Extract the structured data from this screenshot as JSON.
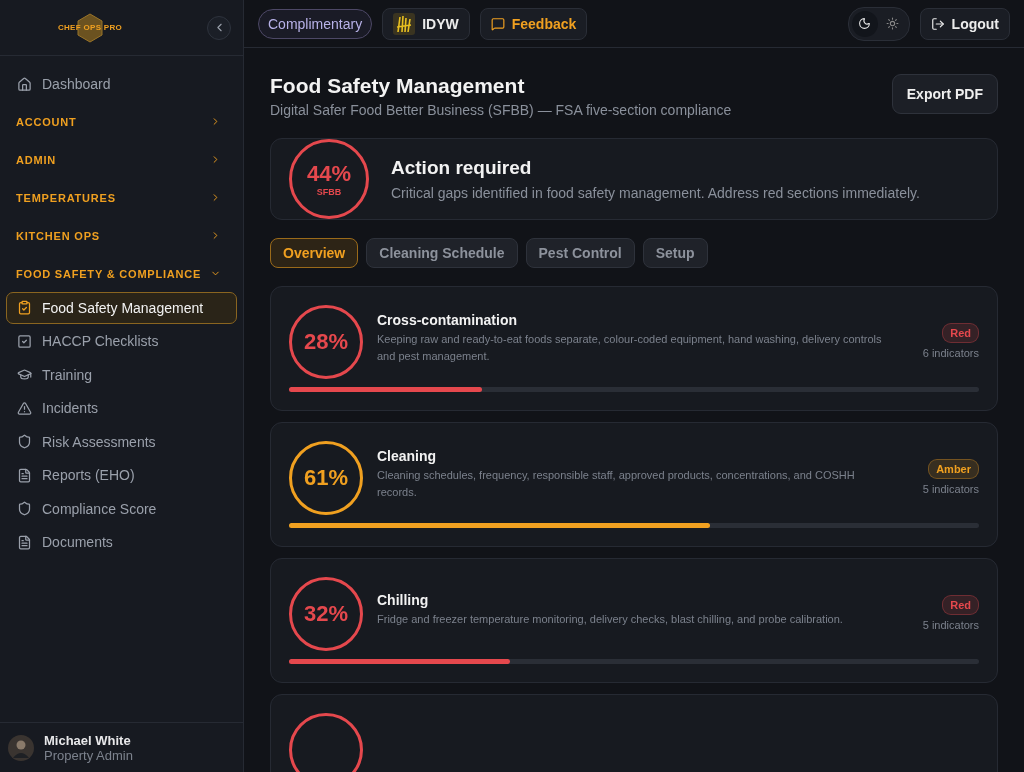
{
  "sidebar": {
    "logo": "CHEF OPS PRO",
    "home": {
      "label": "Dashboard",
      "selected": false
    },
    "groups": [
      {
        "label": "ACCOUNT",
        "expanded": false
      },
      {
        "label": "ADMIN",
        "expanded": false
      },
      {
        "label": "TEMPERATURES",
        "expanded": false
      },
      {
        "label": "KITCHEN OPS",
        "expanded": false
      },
      {
        "label": "FOOD SAFETY & COMPLIANCE",
        "expanded": true,
        "children": [
          {
            "label": "Food Safety Management",
            "selected": true
          },
          {
            "label": "HACCP Checklists",
            "selected": false
          },
          {
            "label": "Training",
            "selected": false
          },
          {
            "label": "Incidents",
            "selected": false
          },
          {
            "label": "Risk Assessments",
            "selected": false
          },
          {
            "label": "Reports (EHO)",
            "selected": false
          },
          {
            "label": "Compliance Score",
            "selected": false
          },
          {
            "label": "Documents",
            "selected": false
          }
        ]
      }
    ],
    "user": {
      "name": "Michael White",
      "role": "Property Admin"
    }
  },
  "topbar": {
    "plan": "Complimentary",
    "venue": "IDYW",
    "feedback": "Feedback",
    "theme": [
      {
        "kind": "dark",
        "selected": true
      },
      {
        "kind": "light",
        "selected": false
      }
    ],
    "logout": "Logout"
  },
  "page": {
    "title": "Food Safety Management",
    "subtitle": "Digital Safer Food Better Business (SFBB) — FSA five-section compliance",
    "export": "Export PDF"
  },
  "score": {
    "value": "44%",
    "label": "SFBB",
    "color": "#e5484d",
    "heading": "Action required",
    "text": "Critical gaps identified in food safety management. Address red sections immediately."
  },
  "tabs": [
    {
      "label": "Overview",
      "selected": true
    },
    {
      "label": "Cleaning Schedule",
      "selected": false
    },
    {
      "label": "Pest Control",
      "selected": false
    },
    {
      "label": "Setup",
      "selected": false
    }
  ],
  "sections": [
    {
      "score": "28%",
      "title": "Cross-contamination",
      "text": "Keeping raw and ready-to-eat foods separate, colour-coded equipment, hand washing, delivery controls and pest management.",
      "color": "#e5484d",
      "badge": "Red",
      "indicators": "6 indicators",
      "level": 0.28
    },
    {
      "score": "61%",
      "title": "Cleaning",
      "text": "Cleaning schedules, frequency, responsible staff, approved products, concentrations, and COSHH records.",
      "color": "#f0a020",
      "badge": "Amber",
      "indicators": "5 indicators",
      "level": 0.61
    },
    {
      "score": "32%",
      "title": "Chilling",
      "text": "Fridge and freezer temperature monitoring, delivery checks, blast chilling, and probe calibration.",
      "color": "#e5484d",
      "badge": "Red",
      "indicators": "5 indicators",
      "level": 0.32
    },
    {
      "color": "#e5484d"
    }
  ]
}
